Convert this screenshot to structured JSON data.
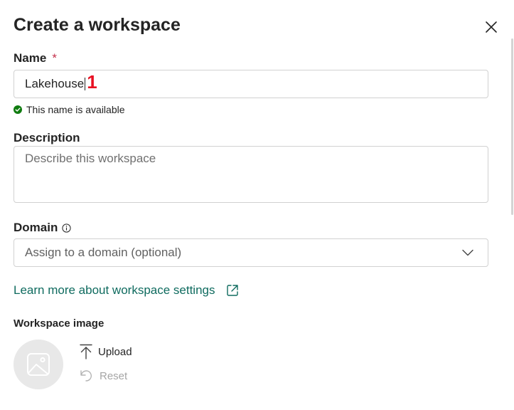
{
  "dialog": {
    "title": "Create a workspace",
    "close_icon": "close-icon"
  },
  "name": {
    "label": "Name",
    "required_mark": "*",
    "value": "Lakehouse",
    "annotation_marker": "1",
    "availability_text": "This name is available",
    "availability_color": "#107c10"
  },
  "description": {
    "label": "Description",
    "placeholder": "Describe this workspace"
  },
  "domain": {
    "label": "Domain",
    "info_icon": "info-icon",
    "placeholder": "Assign to a domain (optional)",
    "chevron_icon": "chevron-down-icon"
  },
  "learn_more": {
    "text": "Learn more about workspace settings",
    "icon": "open-external-icon",
    "color": "#0f6b5f"
  },
  "workspace_image": {
    "label": "Workspace image",
    "placeholder_icon": "image-icon",
    "upload_label": "Upload",
    "upload_icon": "upload-icon",
    "reset_label": "Reset",
    "reset_icon": "undo-icon"
  }
}
